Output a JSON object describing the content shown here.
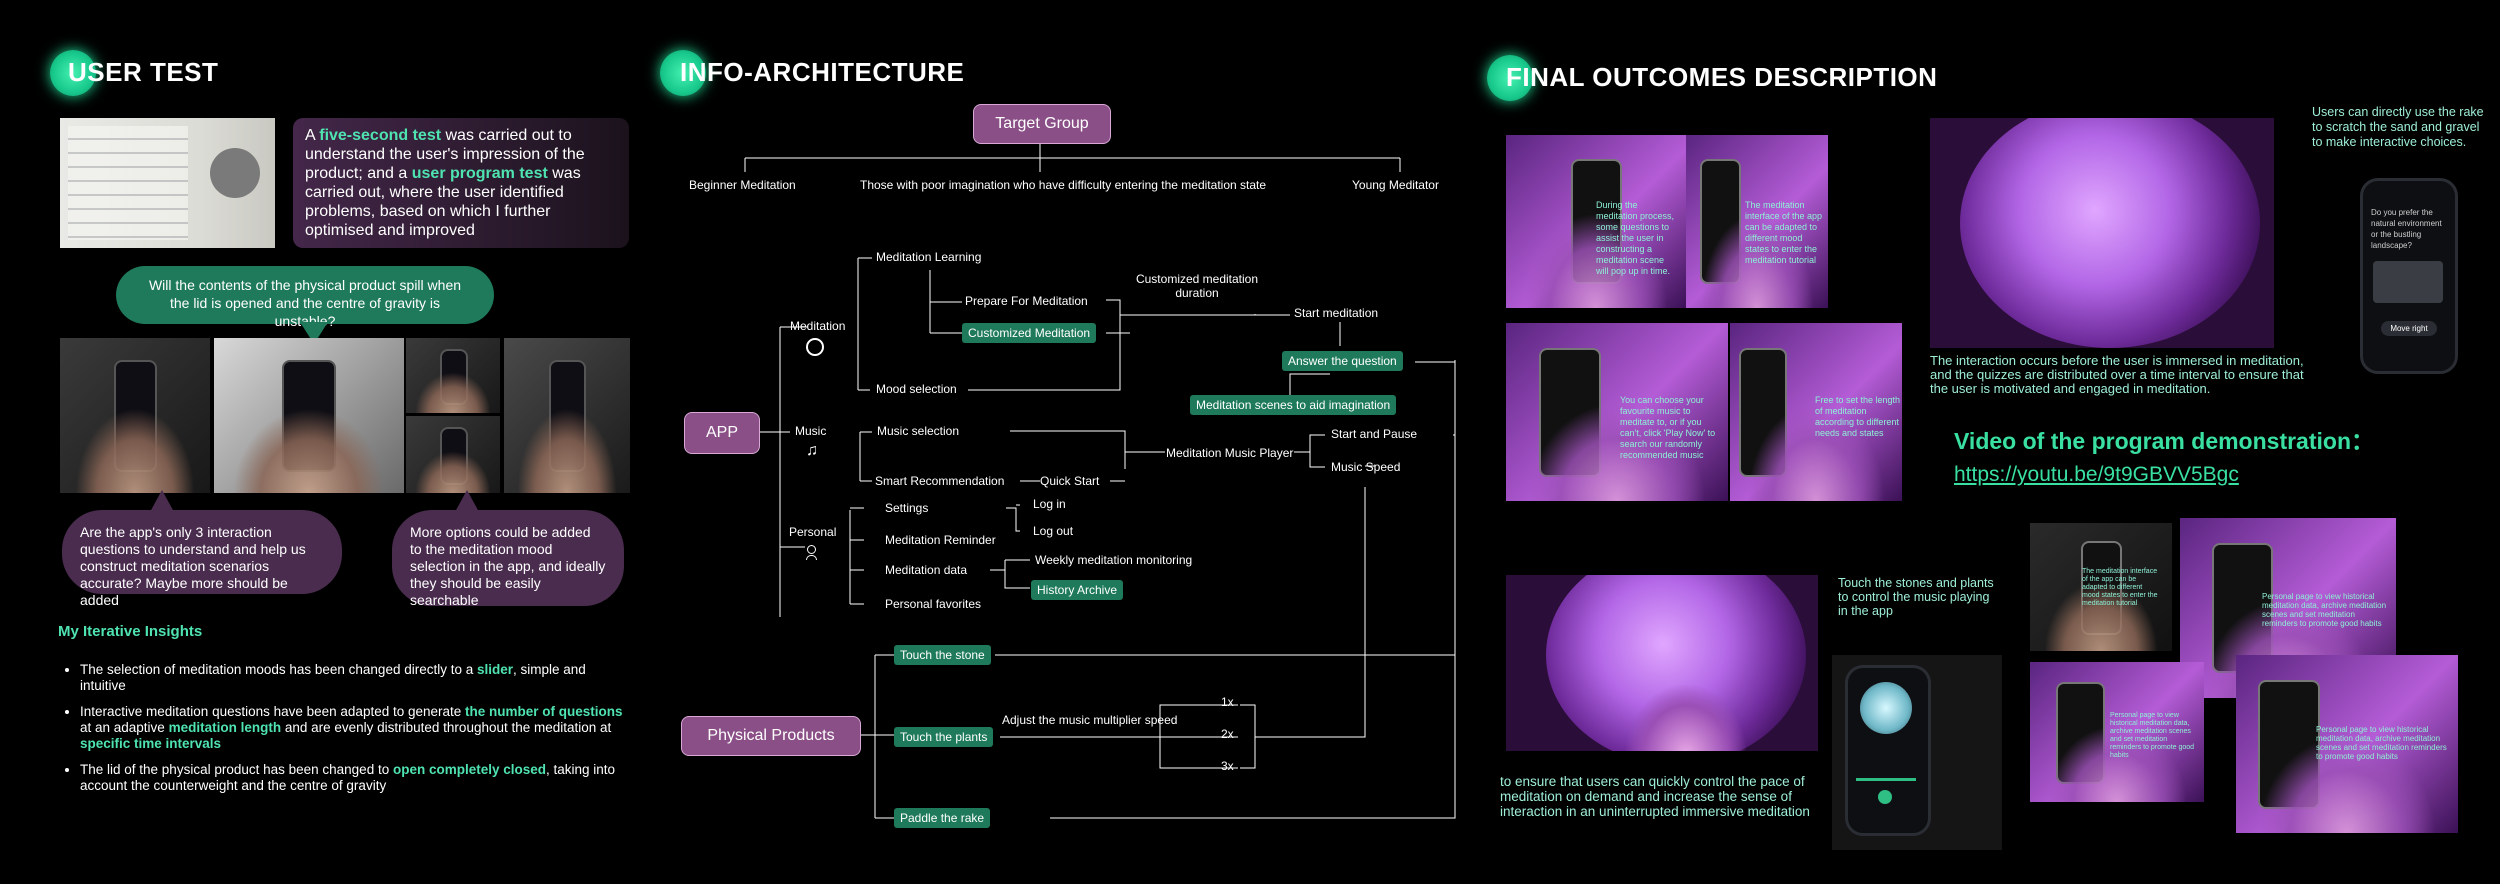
{
  "user_test": {
    "title": "USER TEST",
    "intro": {
      "p1": "A ",
      "h1": "five-second test",
      "p2": " was carried out to understand the user's impression of the product; and a ",
      "h2": "user program test",
      "p3": " was carried out, where the user identified problems, based on which I further optimised and improved"
    },
    "question_green": "Will the contents of the physical product spill when the lid is opened and the centre of gravity is unstable?",
    "question_left": "Are the app's only 3 interaction questions to understand and help us construct meditation scenarios accurate? Maybe more should be added",
    "question_right": "More options could be added to the meditation mood selection in the app, and ideally they should be easily searchable",
    "insights_title": "My Iterative Insights",
    "insight1": {
      "a": "The selection of meditation moods has been changed directly to a ",
      "h": "slider",
      "b": ", simple and intuitive"
    },
    "insight2": {
      "a": "Interactive meditation questions have been adapted to generate ",
      "h1": "the number of questions",
      "b": " at an adaptive ",
      "h2": "meditation length",
      "c": " and are evenly distributed throughout the meditation at ",
      "h3": "specific time intervals"
    },
    "insight3": {
      "a": "The lid of the physical product has been changed to ",
      "h": "open completely closed",
      "b": ", taking into account the counterweight and the centre of gravity"
    }
  },
  "info_arch": {
    "title": "INFO-ARCHITECTURE",
    "target_group": "Target Group",
    "tg1": "Beginner Meditation",
    "tg2": "Those with poor imagination who have difficulty entering the meditation state",
    "tg3": "Young Meditator",
    "app": "APP",
    "meditation": "Meditation",
    "music": "Music",
    "personal": "Personal",
    "med_learning": "Meditation Learning",
    "prepare": "Prepare For Meditation",
    "customized": "Customized Meditation",
    "custom_duration": "Customized meditation duration",
    "start_meditation": "Start meditation",
    "answer": "Answer the question",
    "scenes": "Meditation scenes to aid imagination",
    "mood": "Mood selection",
    "music_selection": "Music selection",
    "smart_rec": "Smart Recommendation",
    "quick_start": "Quick Start",
    "music_player": "Meditation Music Player",
    "start_pause": "Start and Pause",
    "music_speed": "Music Speed",
    "settings": "Settings",
    "log_in": "Log in",
    "log_out": "Log out",
    "reminder": "Meditation Reminder",
    "med_data": "Meditation data",
    "weekly": "Weekly meditation monitoring",
    "history": "History Archive",
    "favorites": "Personal favorites",
    "physical": "Physical Products",
    "touch_stone": "Touch the stone",
    "touch_plants": "Touch the plants",
    "paddle": "Paddle the rake",
    "adjust_speed": "Adjust the music multiplier speed",
    "x1": "1x",
    "x2": "2x",
    "x3": "3x"
  },
  "final": {
    "title": "FINAL OUTCOMES DESCRIPTION",
    "rake_caption": "Users can directly use the rake to scratch the sand and gravel to make interactive choices.",
    "interaction_text": "The interaction occurs before the user is immersed in meditation, and the quizzes are distributed over a time interval to ensure that the user is motivated and engaged in meditation.",
    "video_title": "Video of the program demonstration：",
    "video_link": "https://youtu.be/9t9GBVV5Bgc",
    "touch_caption": "Touch the stones and plants to control the music playing in the app",
    "pace_text": "to ensure that users can quickly control the pace of meditation on demand and increase the sense of interaction in an uninterrupted immersive meditation",
    "cap1": "During the meditation process, some questions to assist the user in constructing a meditation scene will pop up in time.",
    "cap2": "The meditation interface of the app can be adapted to different mood states to enter the meditation tutorial",
    "cap3": "You can choose your favourite music to meditate to, or if you can't, click 'Play Now' to search our randomly recommended music",
    "cap4": "Free to set the length of meditation according to different needs and states",
    "cap5": "The meditation interface of the app can be adapted to different mood states to enter the meditation tutorial",
    "cap6": "Personal page to view historical meditation data, archive meditation scenes and set meditation reminders to promote good habits",
    "cap7": "Personal page to view historical meditation data, archive meditation scenes and set meditation reminders to promote good habits",
    "cap8": "Personal page to view historical meditation data, archive meditation scenes and set meditation reminders to promote good habits",
    "phone_q": "Do you prefer the natural environment or the bustling landscape?",
    "phone_btn": "Move right"
  }
}
